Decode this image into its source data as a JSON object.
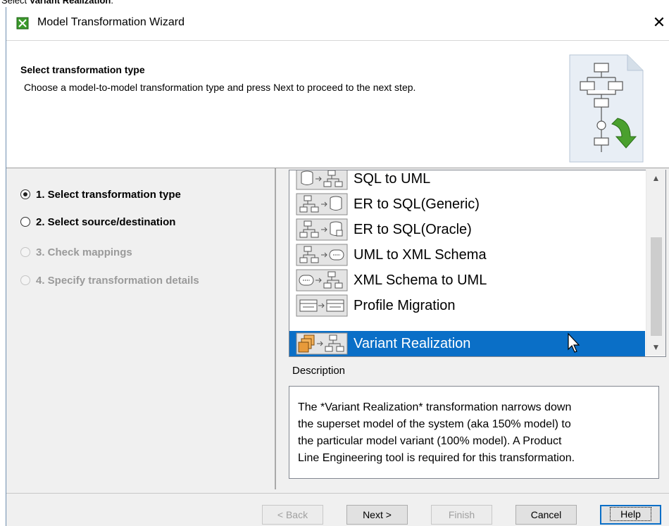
{
  "caption": {
    "prefix": "Select ",
    "bold": "Variant Realization",
    "suffix": "."
  },
  "window": {
    "title": "Model Transformation Wizard",
    "close_glyph": "✕",
    "icon": "wizard-app-icon"
  },
  "header": {
    "title": "Select transformation type",
    "description": "Choose a model-to-model transformation type and press Next to proceed to the next step.",
    "graphic": "flowchart-transform-icon"
  },
  "steps": [
    {
      "label": "1. Select transformation type",
      "selected": true,
      "enabled": true
    },
    {
      "label": "2. Select source/destination",
      "selected": false,
      "enabled": true
    },
    {
      "label": "3. Check mappings",
      "selected": false,
      "enabled": false
    },
    {
      "label": "4. Specify transformation details",
      "selected": false,
      "enabled": false
    }
  ],
  "transformations": [
    {
      "label": "SQL to UML",
      "icon": "sql-to-uml-icon",
      "selected": false
    },
    {
      "label": "ER to SQL(Generic)",
      "icon": "er-to-sql-generic-icon",
      "selected": false
    },
    {
      "label": "ER to SQL(Oracle)",
      "icon": "er-to-sql-oracle-icon",
      "selected": false
    },
    {
      "label": "UML to XML Schema",
      "icon": "uml-to-xml-schema-icon",
      "selected": false
    },
    {
      "label": "XML Schema to UML",
      "icon": "xml-schema-to-uml-icon",
      "selected": false
    },
    {
      "label": "Profile Migration",
      "icon": "profile-migration-icon",
      "selected": false
    },
    {
      "label": "Variant Realization",
      "icon": "variant-realization-icon",
      "selected": true
    }
  ],
  "description": {
    "label": "Description",
    "lines": [
      "The *Variant Realization* transformation narrows down",
      "the superset model of the system (aka 150% model) to",
      "the particular model variant (100% model). A Product",
      "Line Engineering tool is required for this transformation."
    ]
  },
  "buttons": {
    "back": "< Back",
    "next": "Next >",
    "finish": "Finish",
    "cancel": "Cancel",
    "help": "Help"
  },
  "colors": {
    "selection": "#0a6fc7",
    "accent_green": "#3c9a2c",
    "dialog_bg": "#f0f0f0"
  }
}
